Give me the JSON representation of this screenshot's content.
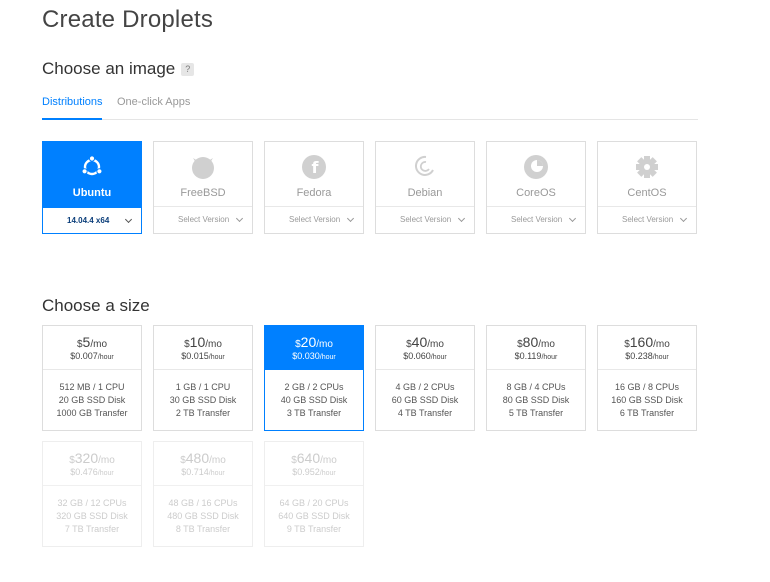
{
  "page": {
    "title": "Create Droplets"
  },
  "image_section": {
    "title": "Choose an image",
    "help": "?",
    "tabs": [
      {
        "label": "Distributions",
        "active": true
      },
      {
        "label": "One-click Apps",
        "active": false
      }
    ],
    "distributions": [
      {
        "name": "Ubuntu",
        "icon": "ubuntu-icon",
        "version": "14.04.4 x64",
        "selected": true
      },
      {
        "name": "FreeBSD",
        "icon": "freebsd-icon",
        "version": "Select Version",
        "selected": false
      },
      {
        "name": "Fedora",
        "icon": "fedora-icon",
        "version": "Select Version",
        "selected": false
      },
      {
        "name": "Debian",
        "icon": "debian-icon",
        "version": "Select Version",
        "selected": false
      },
      {
        "name": "CoreOS",
        "icon": "coreos-icon",
        "version": "Select Version",
        "selected": false
      },
      {
        "name": "CentOS",
        "icon": "centos-icon",
        "version": "Select Version",
        "selected": false
      }
    ]
  },
  "size_section": {
    "title": "Choose a size",
    "sizes": [
      {
        "currency": "$",
        "amount": "5",
        "per": "/mo",
        "hourly": "$0.007",
        "hour_unit": "/hour",
        "ram": "512 MB",
        "cpu": "1 CPU",
        "disk": "20 GB SSD Disk",
        "transfer": "1000 GB Transfer",
        "state": "normal"
      },
      {
        "currency": "$",
        "amount": "10",
        "per": "/mo",
        "hourly": "$0.015",
        "hour_unit": "/hour",
        "ram": "1 GB",
        "cpu": "1 CPU",
        "disk": "30 GB SSD Disk",
        "transfer": "2 TB Transfer",
        "state": "normal"
      },
      {
        "currency": "$",
        "amount": "20",
        "per": "/mo",
        "hourly": "$0.030",
        "hour_unit": "/hour",
        "ram": "2 GB",
        "cpu": "2 CPUs",
        "disk": "40 GB SSD Disk",
        "transfer": "3 TB Transfer",
        "state": "selected"
      },
      {
        "currency": "$",
        "amount": "40",
        "per": "/mo",
        "hourly": "$0.060",
        "hour_unit": "/hour",
        "ram": "4 GB",
        "cpu": "2 CPUs",
        "disk": "60 GB SSD Disk",
        "transfer": "4 TB Transfer",
        "state": "normal"
      },
      {
        "currency": "$",
        "amount": "80",
        "per": "/mo",
        "hourly": "$0.119",
        "hour_unit": "/hour",
        "ram": "8 GB",
        "cpu": "4 CPUs",
        "disk": "80 GB SSD Disk",
        "transfer": "5 TB Transfer",
        "state": "normal"
      },
      {
        "currency": "$",
        "amount": "160",
        "per": "/mo",
        "hourly": "$0.238",
        "hour_unit": "/hour",
        "ram": "16 GB",
        "cpu": "8 CPUs",
        "disk": "160 GB SSD Disk",
        "transfer": "6 TB Transfer",
        "state": "normal"
      },
      {
        "currency": "$",
        "amount": "320",
        "per": "/mo",
        "hourly": "$0.476",
        "hour_unit": "/hour",
        "ram": "32 GB",
        "cpu": "12 CPUs",
        "disk": "320 GB SSD Disk",
        "transfer": "7 TB Transfer",
        "state": "disabled"
      },
      {
        "currency": "$",
        "amount": "480",
        "per": "/mo",
        "hourly": "$0.714",
        "hour_unit": "/hour",
        "ram": "48 GB",
        "cpu": "16 CPUs",
        "disk": "480 GB SSD Disk",
        "transfer": "8 TB Transfer",
        "state": "disabled"
      },
      {
        "currency": "$",
        "amount": "640",
        "per": "/mo",
        "hourly": "$0.952",
        "hour_unit": "/hour",
        "ram": "64 GB",
        "cpu": "20 CPUs",
        "disk": "640 GB SSD Disk",
        "transfer": "9 TB Transfer",
        "state": "disabled"
      }
    ]
  },
  "colors": {
    "accent": "#0080ff",
    "border": "#dddddd",
    "muted_text": "#999999",
    "disabled_text": "#cccccc"
  }
}
